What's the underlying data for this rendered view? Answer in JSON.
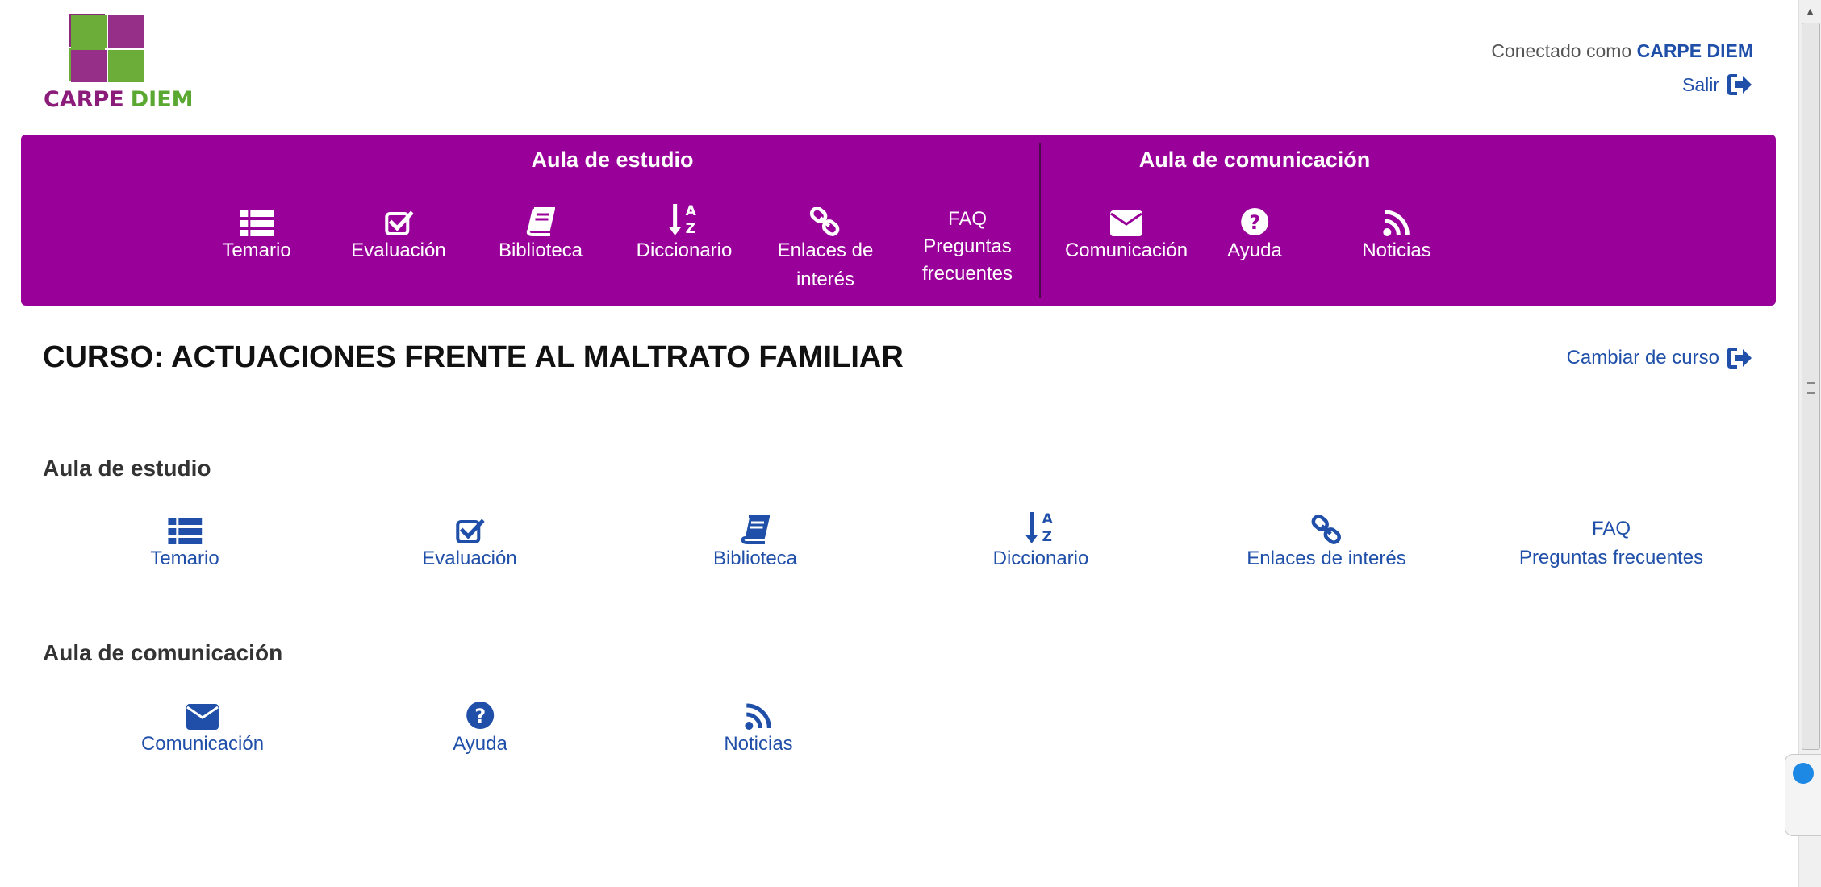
{
  "brand": {
    "word1": "CARPE",
    "word2": "DIEM"
  },
  "user": {
    "connected_prefix": "Conectado como",
    "name": "CARPE DIEM",
    "logout_label": "Salir"
  },
  "nav": {
    "section_study": "Aula de estudio",
    "section_comm": "Aula de comunicación",
    "items": [
      {
        "label": "Temario",
        "icon": "list-icon"
      },
      {
        "label": "Evaluación",
        "icon": "check-square-icon"
      },
      {
        "label": "Biblioteca",
        "icon": "book-icon"
      },
      {
        "label": "Diccionario",
        "icon": "sort-alpha-icon"
      },
      {
        "label": "Enlaces de",
        "label2": "interés",
        "icon": "link-icon"
      },
      {
        "label": "FAQ",
        "label2": "Preguntas",
        "label3": "frecuentes"
      },
      {
        "label": "Comunicación",
        "icon": "envelope-icon"
      },
      {
        "label": "Ayuda",
        "icon": "question-circle-icon"
      },
      {
        "label": "Noticias",
        "icon": "rss-icon"
      }
    ]
  },
  "course": {
    "title": "CURSO: ACTUACIONES FRENTE AL MALTRATO FAMILIAR",
    "change_label": "Cambiar de curso"
  },
  "study": {
    "title": "Aula de estudio",
    "items": [
      {
        "label": "Temario",
        "icon": "list-icon"
      },
      {
        "label": "Evaluación",
        "icon": "check-square-icon"
      },
      {
        "label": "Biblioteca",
        "icon": "book-icon"
      },
      {
        "label": "Diccionario",
        "icon": "sort-alpha-icon"
      },
      {
        "label": "Enlaces de interés",
        "icon": "link-icon"
      },
      {
        "label": "FAQ",
        "label2": "Preguntas frecuentes"
      }
    ]
  },
  "comm": {
    "title": "Aula de comunicación",
    "items": [
      {
        "label": "Comunicación",
        "icon": "envelope-icon"
      },
      {
        "label": "Ayuda",
        "icon": "question-circle-icon"
      },
      {
        "label": "Noticias",
        "icon": "rss-icon"
      }
    ]
  },
  "colors": {
    "nav_bg": "#990099",
    "link": "#1f4fa8",
    "logo_purple": "#8b1c7a",
    "logo_green": "#5aa832"
  }
}
